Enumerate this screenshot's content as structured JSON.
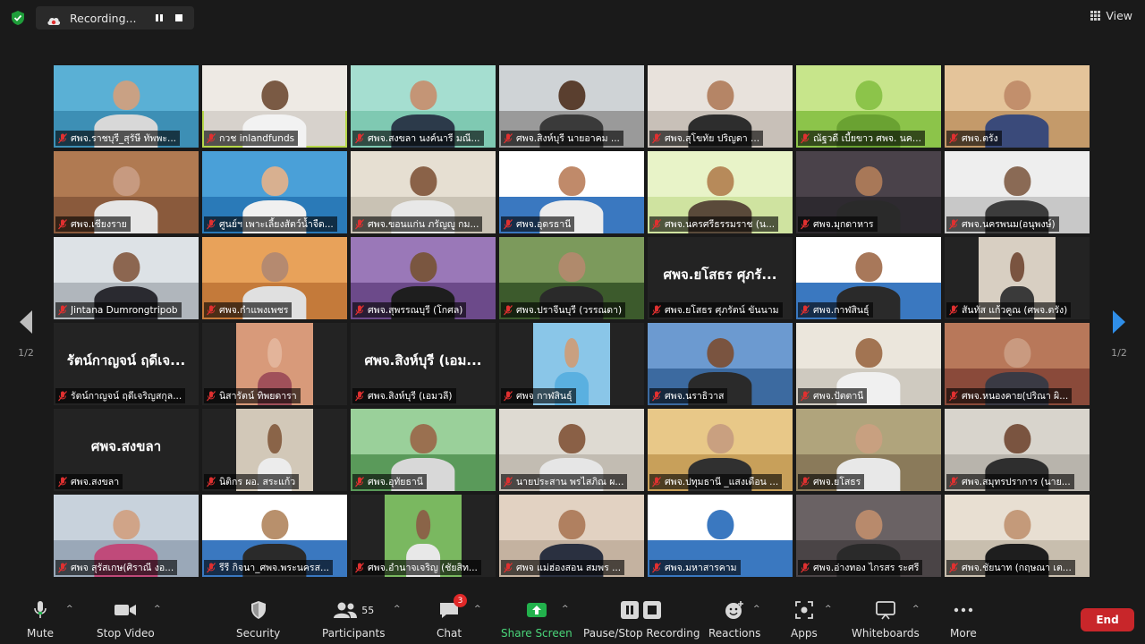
{
  "topbar": {
    "recording_label": "Recording...",
    "view_label": "View"
  },
  "colors": {
    "active_speaker": "#b7d84a",
    "end_button": "#c8262a",
    "share_green": "#22b14c",
    "muted_red": "#e03030"
  },
  "pager": {
    "left": "1/2",
    "right": "1/2"
  },
  "tiles": [
    {
      "name": "ศพจ.ราชบุรี_สุรัษี ทัพพะ...",
      "bg": "#3d8fb5",
      "wall": "#5ab0d5",
      "skin": "#c9a184",
      "shirt": "#d8d8d8"
    },
    {
      "name": "กวช inlandfunds",
      "bg": "#d7d2cc",
      "wall": "#eeeae4",
      "skin": "#7a5a44",
      "shirt": "#f2f2f2",
      "active": true
    },
    {
      "name": "ศพจ.สงขลา นงค์นารี มณี...",
      "bg": "#7fc9b2",
      "wall": "#a5ded0",
      "skin": "#c49576",
      "shirt": "#2c3a4a"
    },
    {
      "name": "ศพจ.สิงห์บุรี นายอาคม ...",
      "bg": "#9a9a9a",
      "wall": "#cfd3d6",
      "skin": "#5a3f2f",
      "shirt": "#3a3a3a"
    },
    {
      "name": "ศพจ.สุโขทัย ปริญดา ...",
      "bg": "#c8c0b8",
      "wall": "#e8e2dc",
      "skin": "#b58566",
      "shirt": "#2d2d2d"
    },
    {
      "name": "ณัฐวดี เบี้ยขาว ศพจ. นค...",
      "bg": "#8cc44a",
      "wall": "#c7e58b",
      "skin": "#8cc44a",
      "shirt": "#6aa232"
    },
    {
      "name": "ศพจ.ตรัง",
      "bg": "#c49a6a",
      "wall": "#e4c49a",
      "skin": "#c28f6c",
      "shirt": "#3a4a7a"
    },
    {
      "name": "ศพจ.เชียงราย",
      "bg": "#8a5a3c",
      "wall": "#b07a52",
      "skin": "#c79a80",
      "shirt": "#e6e6e6"
    },
    {
      "name": "ศูนย์ฯ เพาะเลี้ยงสัตว์น้ำจืด...",
      "bg": "#2a7ab8",
      "wall": "#4aa0d8",
      "skin": "#d8b090",
      "shirt": "#f0f0f0"
    },
    {
      "name": "ศพจ.ขอนแก่น ภรัญญู กม...",
      "bg": "#c9c2b4",
      "wall": "#e6dfd2",
      "skin": "#8a6248",
      "shirt": "#e8e8e8"
    },
    {
      "name": "ศพจ.อุดรธานี",
      "bg": "#3a78c0",
      "wall": "#ffffff",
      "skin": "#c08a6a",
      "shirt": "#ececec"
    },
    {
      "name": "ศพจ.นครศรีธรรมราช (น...",
      "bg": "#cfe3a0",
      "wall": "#e8f3c8",
      "skin": "#b78a5a",
      "shirt": "#5a4a3a"
    },
    {
      "name": "ศพจ.มุกดาหาร",
      "bg": "#2e2a30",
      "wall": "#4a424a",
      "skin": "#a87858",
      "shirt": "#2a2a2a"
    },
    {
      "name": "ศพจ.นครพนม(อนุพงษ์)",
      "bg": "#c8c8c8",
      "wall": "#eeeeee",
      "skin": "#8a6a55",
      "shirt": "#3c3c3c"
    },
    {
      "name": "Jintana Dumrongtripob",
      "bg": "#b0b6bc",
      "wall": "#dde2e6",
      "skin": "#8c6650",
      "shirt": "#2a2a30"
    },
    {
      "name": "ศพจ.กำแพงเพชร",
      "bg": "#c47a3a",
      "wall": "#e8a25a",
      "skin": "#b58a70",
      "shirt": "#e0e0e0"
    },
    {
      "name": "ศพจ.สุพรรณบุรี (โกศล)",
      "bg": "#6c4a8a",
      "wall": "#9a78b8",
      "skin": "#7a5640",
      "shirt": "#1e1e1e"
    },
    {
      "name": "ศพจ.ปราจีนบุรี (วรรณดา)",
      "bg": "#3c5a2c",
      "wall": "#7c9a5c",
      "skin": "#b08a6c",
      "shirt": "#2a2a2a"
    },
    {
      "name": "ศพจ.ยโสธร ศุภรัตน์ ขันนาม",
      "big": "ศพจ.ยโสธร ศุภรั...",
      "bg": "#232323"
    },
    {
      "name": "ศพจ.กาฬสินธุ์",
      "bg": "#3a78c0",
      "wall": "#ffffff",
      "skin": "#a8785a",
      "shirt": "#2a2a2a"
    },
    {
      "name": "สันทัส แก้วคูณ (ศพจ.ตรัง)",
      "bg": "#232323",
      "wall": "#d8cfc2",
      "skin": "#7a5440",
      "shirt": "#3a3a3a",
      "inset": true
    },
    {
      "name": "รัตน์กาญจน์ ฤดีเจริญสกุล...",
      "big": "รัตน์กาญจน์ ฤดีเจ...",
      "bg": "#232323"
    },
    {
      "name": "นิสารัตน์ ทิพยดารา",
      "bg": "#232323",
      "wall": "#d89a7a",
      "skin": "#e3b49a",
      "shirt": "#a0505a",
      "inset": true
    },
    {
      "name": "ศพจ.สิงห์บุรี (เอมวลี)",
      "big": "ศพจ.สิงห์บุรี (เอม...",
      "bg": "#232323"
    },
    {
      "name": "ศพจ กาฬสินธุ์",
      "bg": "#232323",
      "wall": "#8ac6e8",
      "skin": "#c9a080",
      "shirt": "#5ab0e0",
      "inset": true
    },
    {
      "name": "ศพจ.นราธิวาส",
      "bg": "#3c6aa0",
      "wall": "#6c9ad0",
      "skin": "#7a5440",
      "shirt": "#2a2a2a"
    },
    {
      "name": "ศพจ.ปัตตานี",
      "bg": "#cfcac0",
      "wall": "#ebe6dc",
      "skin": "#a27452",
      "shirt": "#f0f0f0"
    },
    {
      "name": "ศพจ.หนองคาย(ปริณา ผิ...",
      "bg": "#8a4a3a",
      "wall": "#b8785a",
      "skin": "#c99a80",
      "shirt": "#3a3a44"
    },
    {
      "name": "ศพจ.สงขลา",
      "big": "ศพจ.สงขลา",
      "bg": "#232323"
    },
    {
      "name": "นิติกร ผอ. สระแก้ว",
      "bg": "#232323",
      "wall": "#d2c8b8",
      "skin": "#8a6448",
      "shirt": "#ececec",
      "inset": true
    },
    {
      "name": "ศพจ.อุทัยธานี",
      "bg": "#5a9a5a",
      "wall": "#9ad09a",
      "skin": "#9a7050",
      "shirt": "#d8d8d8"
    },
    {
      "name": "นายประสาน พรไสภิณ ผ...",
      "bg": "#c2bcb2",
      "wall": "#dedad2",
      "skin": "#8a6046",
      "shirt": "#e6e6e6"
    },
    {
      "name": "ศพจ.ปทุมธานี _แสงเดือน ...",
      "bg": "#c8a05a",
      "wall": "#e8c888",
      "skin": "#c9a080",
      "shirt": "#303030"
    },
    {
      "name": "ศพจ.ยโสธร",
      "bg": "#8a7a5a",
      "wall": "#b0a47c",
      "skin": "#c8a080",
      "shirt": "#e8e8e8"
    },
    {
      "name": "ศพจ.สมุทรปราการ (นาย...",
      "bg": "#b8b4ac",
      "wall": "#d8d4cc",
      "skin": "#7a5440",
      "shirt": "#2e2e2e"
    },
    {
      "name": "ศพจ สุรัสเกษ(ศิราณี งอ...",
      "bg": "#9aa8b8",
      "wall": "#c8d2dc",
      "skin": "#d0a488",
      "shirt": "#c04a7a"
    },
    {
      "name": "รีรี กิจนา_ศพจ.พระนครส...",
      "bg": "#3a78c0",
      "wall": "#ffffff",
      "skin": "#b8906c",
      "shirt": "#2a2a2a"
    },
    {
      "name": "ศพจ.อำนาจเจริญ (ชัยสิท...",
      "bg": "#232323",
      "wall": "#7ab860",
      "skin": "#8a6448",
      "shirt": "#e8e8e8",
      "inset": true
    },
    {
      "name": "ศพจ แม่ฮ่องสอน สมพร ...",
      "bg": "#c4b2a0",
      "wall": "#e2d2c2",
      "skin": "#b08060",
      "shirt": "#2a3040"
    },
    {
      "name": "ศพจ.มหาสารคาม",
      "bg": "#3a78c0",
      "wall": "#ffffff",
      "skin": "#3a78c0",
      "shirt": "#3a78c0"
    },
    {
      "name": "ศพจ.อ่างทอง ไกรสร ระศรี",
      "bg": "#4a4446",
      "wall": "#6a6264",
      "skin": "#b88a6c",
      "shirt": "#2a2a2a"
    },
    {
      "name": "ศพจ.ชัยนาท (กฤษณา เต...",
      "bg": "#c8beae",
      "wall": "#e8dfd2",
      "skin": "#c49a7a",
      "shirt": "#1e1e1e"
    }
  ],
  "toolbar": {
    "mute": "Mute",
    "stop_video": "Stop Video",
    "security": "Security",
    "participants": "Participants",
    "participants_count": "55",
    "chat": "Chat",
    "chat_badge": "3",
    "share_screen": "Share Screen",
    "pause_stop_recording": "Pause/Stop Recording",
    "reactions": "Reactions",
    "apps": "Apps",
    "whiteboards": "Whiteboards",
    "more": "More",
    "end": "End"
  }
}
